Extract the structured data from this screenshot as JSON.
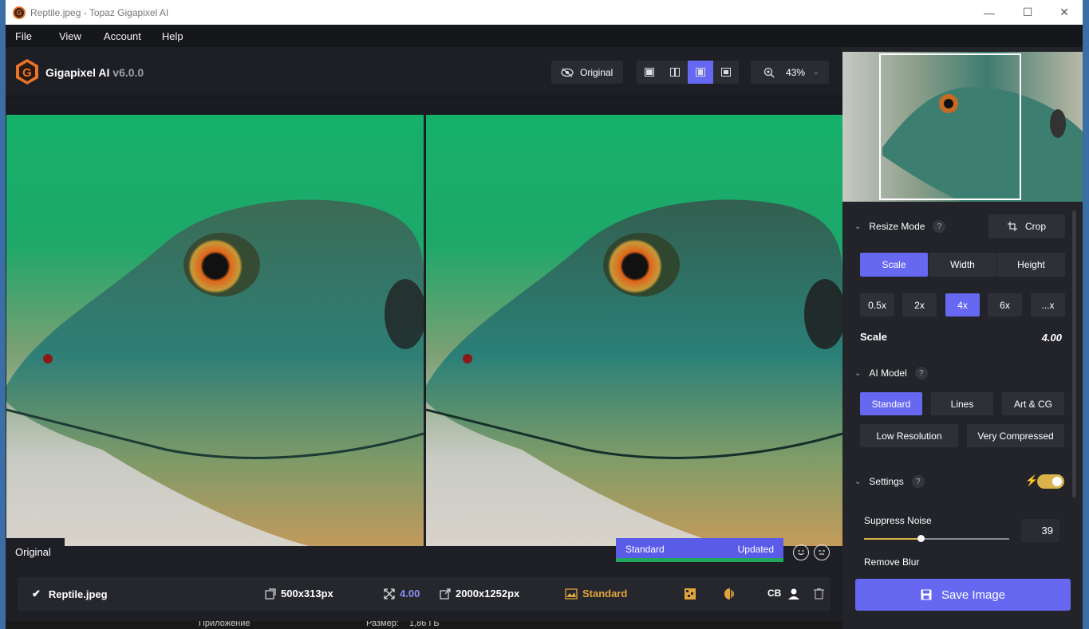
{
  "window": {
    "title": "Reptile.jpeg - Topaz Gigapixel AI",
    "app_icon_letter": "G",
    "minimize": "—",
    "maximize": "☐",
    "close": "✕"
  },
  "menu": {
    "file": "File",
    "view": "View",
    "account": "Account",
    "help": "Help"
  },
  "brand": {
    "name": "Gigapixel AI",
    "version": "v6.0.0",
    "logo_letter": "G",
    "accent": "#e8742a"
  },
  "toolbar": {
    "original_label": "Original",
    "zoom_value": "43%",
    "active_view": "split-compare"
  },
  "preview": {
    "left_label": "Original",
    "model_name": "Standard",
    "model_status": "Updated"
  },
  "bottom": {
    "filename": "Reptile.jpeg",
    "input_size": "500x313px",
    "scale": "4.00",
    "output_size": "2000x1252px",
    "model": "Standard",
    "cb_label": "CB"
  },
  "taskbar": {
    "text_left": "Приложение",
    "text_right": "Размер:",
    "size_value": "1,86 ГБ"
  },
  "panel": {
    "resize_mode_label": "Resize Mode",
    "help_glyph": "?",
    "crop_label": "Crop",
    "modes": [
      "Scale",
      "Width",
      "Height"
    ],
    "active_mode": "Scale",
    "scale_options": [
      "0.5x",
      "2x",
      "4x",
      "6x",
      "...x"
    ],
    "active_scale": "4x",
    "scale_label": "Scale",
    "scale_value": "4.00",
    "ai_model_label": "AI Model",
    "models_row1": [
      "Standard",
      "Lines",
      "Art & CG"
    ],
    "models_row2": [
      "Low Resolution",
      "Very Compressed"
    ],
    "active_model": "Standard",
    "settings_label": "Settings",
    "settings_enabled": true,
    "suppress_noise_label": "Suppress Noise",
    "suppress_noise_value": "39",
    "suppress_noise_fraction": 0.39,
    "remove_blur_label": "Remove Blur",
    "save_label": "Save Image"
  }
}
